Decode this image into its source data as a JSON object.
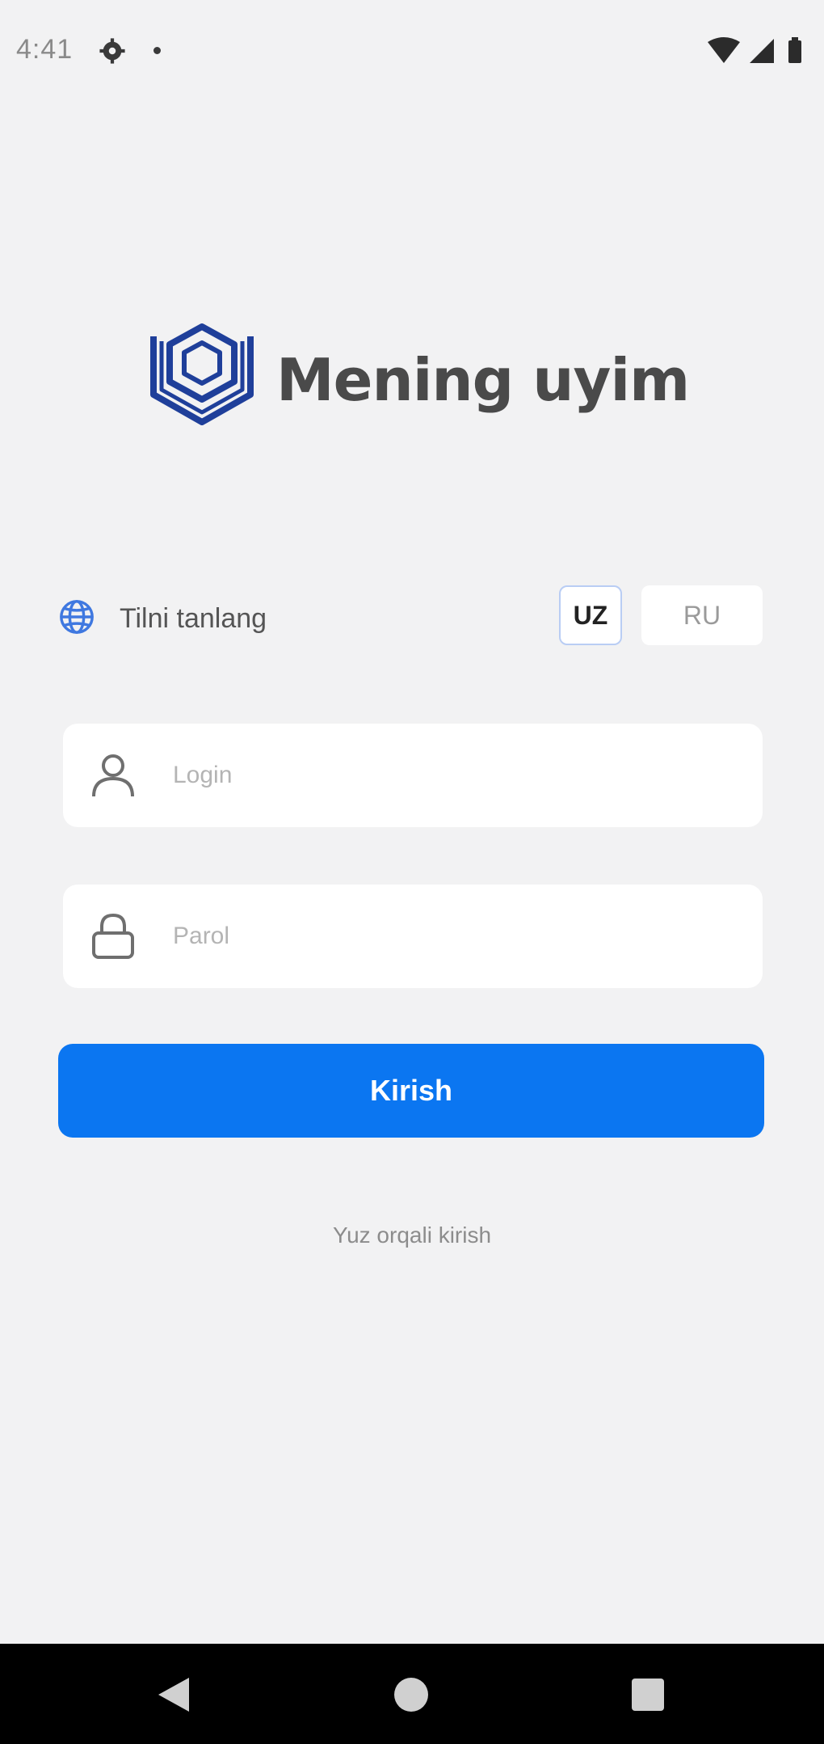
{
  "status_bar": {
    "time": "4:41",
    "icons": [
      "gear-icon",
      "dot-icon",
      "wifi-icon",
      "signal-icon",
      "battery-icon"
    ]
  },
  "brand": {
    "name": "Mening uyim",
    "logo_icon": "house-shield-logo",
    "logo_color": "#1f3f9a"
  },
  "language": {
    "label": "Tilni tanlang",
    "icon": "globe-icon",
    "options": [
      "UZ",
      "RU"
    ],
    "selected": "UZ"
  },
  "form": {
    "login_placeholder": "Login",
    "login_icon": "user-icon",
    "password_placeholder": "Parol",
    "password_icon": "lock-icon",
    "submit_label": "Kirish",
    "submit_color": "#0b76f1"
  },
  "face_id_link": "Yuz orqali kirish",
  "nav_bar": {
    "icons": [
      "back-icon",
      "home-icon",
      "recents-icon"
    ]
  }
}
